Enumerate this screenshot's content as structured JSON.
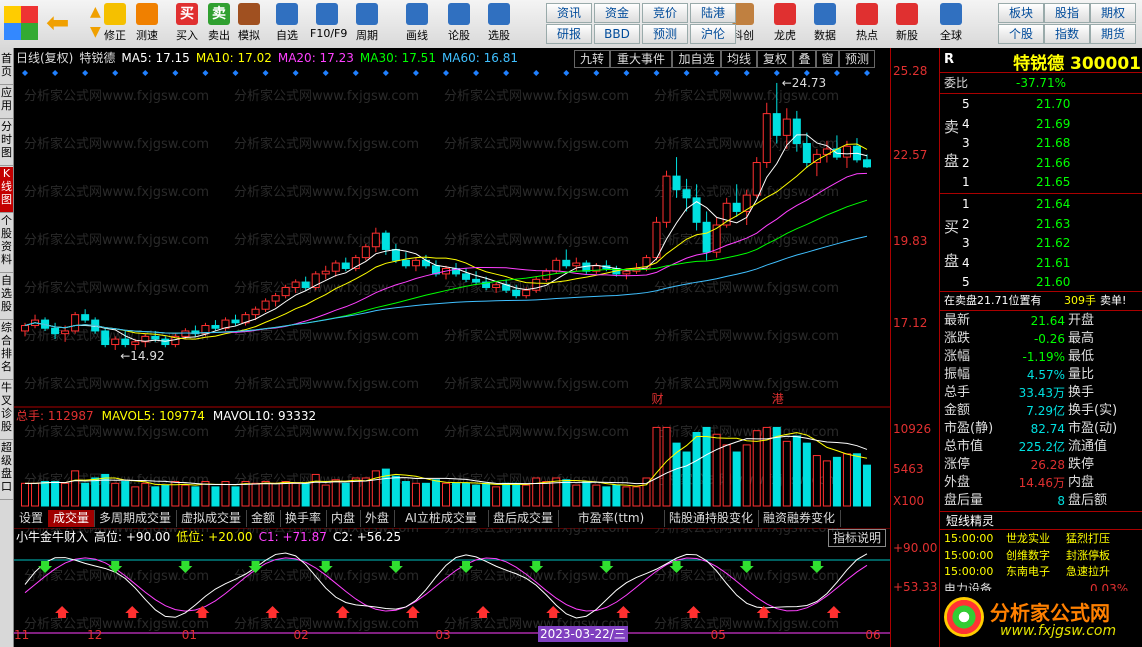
{
  "toolbar": {
    "buttons": [
      {
        "label": "修正",
        "icon": "correct-icon"
      },
      {
        "label": "测速",
        "icon": "speed-test-icon"
      },
      {
        "label": "买入",
        "icon": "buy-icon",
        "glyph": "买"
      },
      {
        "label": "卖出",
        "icon": "sell-icon",
        "glyph": "卖"
      },
      {
        "label": "模拟",
        "icon": "hammer-icon"
      },
      {
        "label": "自选",
        "icon": "star-icon"
      },
      {
        "label": "F10/F9",
        "icon": "f10-icon"
      },
      {
        "label": "周期",
        "icon": "period-icon"
      },
      {
        "label": "画线",
        "icon": "pencil-icon"
      },
      {
        "label": "论股",
        "icon": "discuss-icon"
      },
      {
        "label": "选股",
        "icon": "stock-pick-icon"
      },
      {
        "label": "科创",
        "icon": "sci-tech-icon"
      },
      {
        "label": "龙虎",
        "icon": "dragon-tiger-icon"
      },
      {
        "label": "数据",
        "icon": "data-icon"
      },
      {
        "label": "热点",
        "icon": "hot-icon"
      },
      {
        "label": "新股",
        "icon": "new-stock-icon"
      },
      {
        "label": "全球",
        "icon": "globe-icon"
      }
    ],
    "quick_grid": [
      [
        "资讯",
        "资金",
        "竞价",
        "陆港"
      ],
      [
        "研报",
        "BBD",
        "预测",
        "沪伦"
      ]
    ],
    "right_grid": [
      [
        "板块",
        "股指",
        "期权"
      ],
      [
        "个股",
        "指数",
        "期货"
      ]
    ]
  },
  "sidebar": [
    "首页",
    "应用",
    "分时图",
    "K线图",
    "个股资料",
    "自选股",
    "综合排名",
    "牛叉诊股",
    "超级盘口"
  ],
  "header": {
    "period": "日线(复权)",
    "name": "特锐德",
    "ma": [
      {
        "label": "MA5: 17.15",
        "color": "#ffffff"
      },
      {
        "label": "MA10: 17.02",
        "color": "#ffff00"
      },
      {
        "label": "MA20: 17.23",
        "color": "#ff40ff"
      },
      {
        "label": "MA30: 17.51",
        "color": "#00ff00"
      },
      {
        "label": "MA60: 16.81",
        "color": "#40c0ff"
      }
    ],
    "tools": [
      "九转",
      "重大事件",
      "加自选",
      "均线",
      "复权",
      "叠",
      "窗",
      "预测"
    ]
  },
  "chart_data": [
    {
      "type": "candlestick",
      "title": "",
      "y_ticks": [
        "25.28",
        "22.57",
        "19.83",
        "17.12"
      ],
      "annotations": [
        "24.73",
        "14.92",
        "财",
        "港"
      ],
      "x_ticks": [
        "11",
        "12",
        "01",
        "02",
        "03",
        "05",
        "06"
      ],
      "x_tick_pos": [
        0,
        0.085,
        0.195,
        0.325,
        0.49,
        0.81,
        0.99
      ],
      "ylim": [
        13.5,
        25.28
      ],
      "candles": [
        [
          15.6,
          15.9,
          15.4,
          15.8
        ],
        [
          15.8,
          16.2,
          15.7,
          16.0
        ],
        [
          16.0,
          16.1,
          15.6,
          15.7
        ],
        [
          15.7,
          15.9,
          15.3,
          15.5
        ],
        [
          15.5,
          15.8,
          15.2,
          15.6
        ],
        [
          15.6,
          16.3,
          15.5,
          16.2
        ],
        [
          16.2,
          16.4,
          15.9,
          16.0
        ],
        [
          16.0,
          16.1,
          15.5,
          15.6
        ],
        [
          15.6,
          15.7,
          15.0,
          15.1
        ],
        [
          15.1,
          15.4,
          14.9,
          15.3
        ],
        [
          15.3,
          15.6,
          15.0,
          15.1
        ],
        [
          15.1,
          15.3,
          14.9,
          15.2
        ],
        [
          15.2,
          15.5,
          15.0,
          15.4
        ],
        [
          15.4,
          15.6,
          15.2,
          15.3
        ],
        [
          15.3,
          15.4,
          15.0,
          15.1
        ],
        [
          15.1,
          15.5,
          15.0,
          15.4
        ],
        [
          15.4,
          15.7,
          15.3,
          15.6
        ],
        [
          15.6,
          15.8,
          15.4,
          15.5
        ],
        [
          15.5,
          15.9,
          15.4,
          15.8
        ],
        [
          15.8,
          16.0,
          15.6,
          15.7
        ],
        [
          15.7,
          16.1,
          15.6,
          16.0
        ],
        [
          16.0,
          16.2,
          15.8,
          15.9
        ],
        [
          15.9,
          16.3,
          15.8,
          16.2
        ],
        [
          16.2,
          16.5,
          16.0,
          16.4
        ],
        [
          16.4,
          16.8,
          16.3,
          16.7
        ],
        [
          16.7,
          17.0,
          16.5,
          16.9
        ],
        [
          16.9,
          17.3,
          16.8,
          17.2
        ],
        [
          17.2,
          17.5,
          17.0,
          17.4
        ],
        [
          17.4,
          17.6,
          17.1,
          17.2
        ],
        [
          17.2,
          17.8,
          17.1,
          17.7
        ],
        [
          17.7,
          18.0,
          17.5,
          17.8
        ],
        [
          17.8,
          18.2,
          17.6,
          18.1
        ],
        [
          18.1,
          18.3,
          17.8,
          17.9
        ],
        [
          17.9,
          18.4,
          17.8,
          18.3
        ],
        [
          18.3,
          18.8,
          18.2,
          18.7
        ],
        [
          18.7,
          19.4,
          18.5,
          19.2
        ],
        [
          19.2,
          19.3,
          18.4,
          18.6
        ],
        [
          18.6,
          18.8,
          18.1,
          18.2
        ],
        [
          18.2,
          18.5,
          17.9,
          18.0
        ],
        [
          18.0,
          18.3,
          17.8,
          18.2
        ],
        [
          18.2,
          18.4,
          17.9,
          18.0
        ],
        [
          18.0,
          18.2,
          17.6,
          17.7
        ],
        [
          17.7,
          18.0,
          17.5,
          17.9
        ],
        [
          17.9,
          18.1,
          17.6,
          17.7
        ],
        [
          17.7,
          17.9,
          17.4,
          17.5
        ],
        [
          17.5,
          17.8,
          17.3,
          17.4
        ],
        [
          17.4,
          17.6,
          17.1,
          17.2
        ],
        [
          17.2,
          17.4,
          17.0,
          17.3
        ],
        [
          17.3,
          17.5,
          17.0,
          17.1
        ],
        [
          17.1,
          17.3,
          16.8,
          16.9
        ],
        [
          16.9,
          17.2,
          16.8,
          17.1
        ],
        [
          17.1,
          17.6,
          17.0,
          17.5
        ],
        [
          17.5,
          17.9,
          17.4,
          17.8
        ],
        [
          17.8,
          18.3,
          17.7,
          18.2
        ],
        [
          18.2,
          18.6,
          17.9,
          18.0
        ],
        [
          18.0,
          18.3,
          17.8,
          18.1
        ],
        [
          18.1,
          18.2,
          17.7,
          17.8
        ],
        [
          17.8,
          18.1,
          17.7,
          18.0
        ],
        [
          18.0,
          18.2,
          17.8,
          17.9
        ],
        [
          17.9,
          18.0,
          17.6,
          17.7
        ],
        [
          17.7,
          17.9,
          17.5,
          17.8
        ],
        [
          17.8,
          18.1,
          17.7,
          17.9
        ],
        [
          17.9,
          18.4,
          17.8,
          18.3
        ],
        [
          18.3,
          19.8,
          18.2,
          19.6
        ],
        [
          19.6,
          21.5,
          19.4,
          21.3
        ],
        [
          21.3,
          22.0,
          20.5,
          20.8
        ],
        [
          20.8,
          21.2,
          20.0,
          20.5
        ],
        [
          20.5,
          21.0,
          19.3,
          19.6
        ],
        [
          19.6,
          20.0,
          18.2,
          18.5
        ],
        [
          18.5,
          19.8,
          18.3,
          19.5
        ],
        [
          19.5,
          20.5,
          19.4,
          20.3
        ],
        [
          20.3,
          21.0,
          19.8,
          20.0
        ],
        [
          20.0,
          20.8,
          19.5,
          20.6
        ],
        [
          20.6,
          22.0,
          20.5,
          21.8
        ],
        [
          21.8,
          24.0,
          21.6,
          23.6
        ],
        [
          23.6,
          24.73,
          22.5,
          22.8
        ],
        [
          22.8,
          23.8,
          22.3,
          23.4
        ],
        [
          23.4,
          23.7,
          22.2,
          22.5
        ],
        [
          22.5,
          22.9,
          21.6,
          21.8
        ],
        [
          21.8,
          22.3,
          21.3,
          22.1
        ],
        [
          22.1,
          22.6,
          21.8,
          22.3
        ],
        [
          22.3,
          22.8,
          21.9,
          22.0
        ],
        [
          22.0,
          22.6,
          21.6,
          22.4
        ],
        [
          22.4,
          22.7,
          21.8,
          21.9
        ],
        [
          21.9,
          22.1,
          21.6,
          21.64
        ]
      ],
      "ma_series": [
        {
          "color": "#ffffff",
          "period": 5
        },
        {
          "color": "#ffff00",
          "period": 10
        },
        {
          "color": "#ff40ff",
          "period": 20
        },
        {
          "color": "#00ff00",
          "period": 30
        },
        {
          "color": "#40c0ff",
          "period": 60
        }
      ]
    },
    {
      "type": "bar",
      "title": "",
      "legend": [
        {
          "label": "总手: 112987",
          "color": "#e03030"
        },
        {
          "label": "MAVOL5: 109774",
          "color": "#ffff00"
        },
        {
          "label": "MAVOL10: 93332",
          "color": "#ffffff"
        }
      ],
      "y_ticks": [
        "10926",
        "5463",
        "X100"
      ],
      "ylim": [
        0,
        12000
      ]
    },
    {
      "type": "line",
      "title": "",
      "legend": [
        {
          "label": "小牛金牛财入",
          "color": "#ffffff"
        },
        {
          "label": "高位: +90.00",
          "color": "#ffffff"
        },
        {
          "label": "低位: +20.00",
          "color": "#ffff00"
        },
        {
          "label": "C1: +71.87",
          "color": "#ff40ff"
        },
        {
          "label": "C2: +56.25",
          "color": "#ffffff"
        }
      ],
      "y_ticks": [
        "+90.00",
        "+53.33"
      ],
      "ylim": [
        0,
        110
      ],
      "button": "指标说明"
    }
  ],
  "vol_tabs": [
    "设置",
    "成交量",
    "多周期成交量",
    "虚拟成交量",
    "金额",
    "换手率",
    "内盘",
    "外盘",
    "AI立桩成交量",
    "盘后成交量",
    "市盈率(ttm)",
    "陆股通持股变化",
    "融资融券变化"
  ],
  "date_badge": "2023-03-22/三",
  "panel": {
    "code": "R",
    "name": "特锐德 300001",
    "weibi_label": "委比",
    "weibi": "-37.71%",
    "sell_label": [
      "卖",
      "盘"
    ],
    "buy_label": [
      "买",
      "盘"
    ],
    "sells": [
      [
        "5",
        "21.70"
      ],
      [
        "4",
        "21.69"
      ],
      [
        "3",
        "21.68"
      ],
      [
        "2",
        "21.66"
      ],
      [
        "1",
        "21.65"
      ]
    ],
    "buys": [
      [
        "1",
        "21.64"
      ],
      [
        "2",
        "21.63"
      ],
      [
        "3",
        "21.62"
      ],
      [
        "4",
        "21.61"
      ],
      [
        "5",
        "21.60"
      ]
    ],
    "order_note": "在卖盘21.71位置有",
    "order_qty": "309手",
    "order_tag": "卖单!",
    "stats": [
      [
        "最新",
        "21.64",
        "开盘",
        ""
      ],
      [
        "涨跌",
        "-0.26",
        "最高",
        ""
      ],
      [
        "涨幅",
        "-1.19%",
        "最低",
        ""
      ],
      [
        "振幅",
        "4.57%",
        "量比",
        ""
      ],
      [
        "总手",
        "33.43万",
        "换手",
        ""
      ],
      [
        "金额",
        "7.29亿",
        "换手(实)",
        ""
      ],
      [
        "市盈(静)",
        "82.74",
        "市盈(动)",
        ""
      ],
      [
        "总市值",
        "225.2亿",
        "流通值",
        ""
      ],
      [
        "涨停",
        "26.28",
        "跌停",
        ""
      ],
      [
        "外盘",
        "14.46万",
        "内盘",
        ""
      ],
      [
        "盘后量",
        "8",
        "盘后额",
        ""
      ]
    ],
    "wizard_title": "短线精灵",
    "wizard": [
      [
        "15:00:00",
        "世龙实业",
        "猛烈打压"
      ],
      [
        "15:00:00",
        "创维数字",
        "封涨停板"
      ],
      [
        "15:00:00",
        "东南电子",
        "急速拉升"
      ]
    ],
    "wizard_partial": "电力设备",
    "wizard_partial_val": "0.03%"
  },
  "watermark": "分析家公式网www.fxjgsw.com",
  "logo": {
    "title": "分析家公式网",
    "url": "www.fxjgsw.com"
  }
}
